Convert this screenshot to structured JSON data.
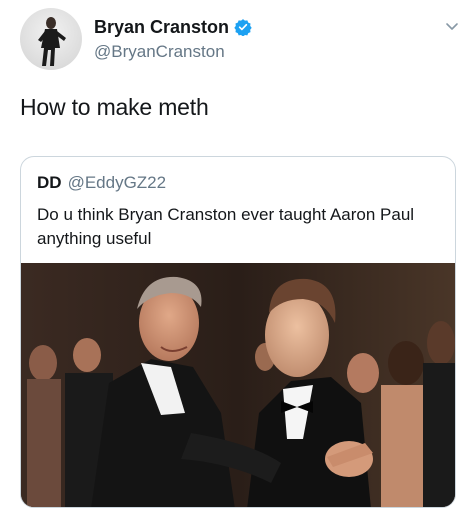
{
  "tweet": {
    "author": {
      "display_name": "Bryan Cranston",
      "handle": "@BryanCranston",
      "verified_icon": "verified-badge-icon",
      "avatar_icon": "avatar"
    },
    "menu_icon": "chevron-down-icon",
    "text": "How to make meth",
    "quoted": {
      "display_name": "DD",
      "handle": "@EddyGZ22",
      "text": "Do u think Bryan Cranston ever taught Aaron Paul anything useful",
      "media": "photo"
    }
  },
  "colors": {
    "text_primary": "#14171a",
    "text_secondary": "#657786",
    "border": "#ccd6dd",
    "verified_blue": "#1da1f2"
  }
}
